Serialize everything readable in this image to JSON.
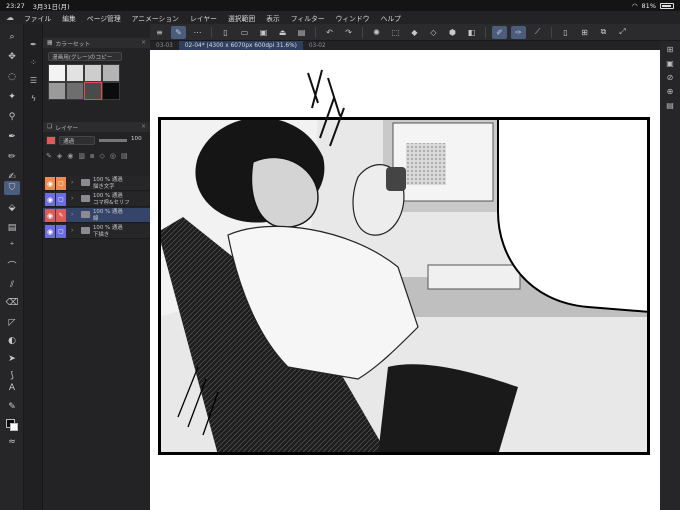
{
  "status": {
    "time": "23:27",
    "date": "3月31日(月)",
    "battery": "81%"
  },
  "menu": [
    "ファイル",
    "編集",
    "ページ管理",
    "アニメーション",
    "レイヤー",
    "選択範囲",
    "表示",
    "フィルター",
    "ウィンドウ",
    "ヘルプ"
  ],
  "tabs": [
    {
      "label": "03-03"
    },
    {
      "label": "02-04* (4300 x 6070px 600dpi 31.6%)"
    },
    {
      "label": "03-02"
    }
  ],
  "color_set": {
    "title": "カラーセット",
    "preset": "漫画用(グレー)のコピー",
    "swatches": [
      "#f3f3f3",
      "#e2e2e2",
      "#cdcdcd",
      "#b4b4b4",
      "#9a9a9a",
      "#6e6e6e",
      "#4a4a4a",
      "#0c0c0c"
    ]
  },
  "layer_panel": {
    "title": "レイヤー",
    "blend_mode": "通過",
    "opacity": "100",
    "layers": [
      {
        "line1": "100 % 通過",
        "line2": "描き文字",
        "eye_color": "#f08a52",
        "lock_color": "#f08a52"
      },
      {
        "line1": "100 % 通過",
        "line2": "コマ枠&セリフ",
        "eye_color": "#6a6ee0",
        "lock_color": "#6a6ee0"
      },
      {
        "line1": "100 % 通過",
        "line2": "線",
        "eye_color": "#e05a5a",
        "lock_color": "#e05a5a"
      },
      {
        "line1": "100 % 通過",
        "line2": "下描き",
        "eye_color": "#6a6ee0",
        "lock_color": "#6a6ee0"
      }
    ]
  },
  "colors": {
    "accent": "#4b5d7c",
    "tab_active": "#2f3f5d",
    "selected_layer": "#35456a"
  }
}
